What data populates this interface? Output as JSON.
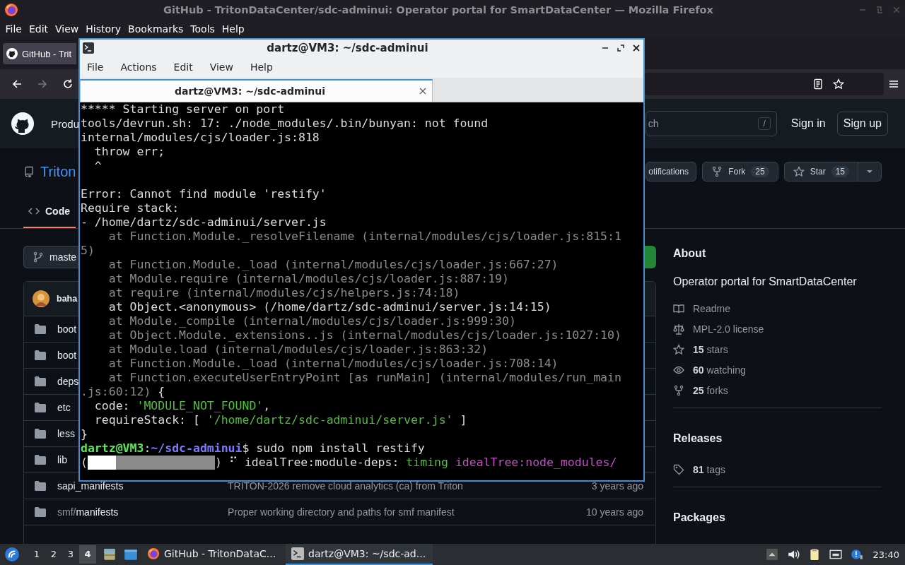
{
  "browser": {
    "title": "GitHub - TritonDataCenter/sdc-adminui: Operator portal for SmartDataCenter — Mozilla Firefox",
    "menu": [
      "File",
      "Edit",
      "View",
      "History",
      "Bookmarks",
      "Tools",
      "Help"
    ],
    "tab": {
      "label": "GitHub - Trit",
      "selected": true
    }
  },
  "github": {
    "nav_item": "Produ",
    "search": {
      "placeholder": "ch",
      "key": "/"
    },
    "sign_in": "Sign in",
    "sign_up": "Sign up",
    "repo_name": "Triton",
    "actions": [
      {
        "kind": "notifications",
        "label": "otifications"
      },
      {
        "kind": "fork",
        "label": "Fork",
        "count": "25"
      },
      {
        "kind": "star",
        "label": "Star",
        "count": "15"
      }
    ],
    "tabs": [
      {
        "label": "Code",
        "selected": true
      }
    ],
    "branch": "maste",
    "commit_author": "baha",
    "files": [
      {
        "name": "boot"
      },
      {
        "name": "boot"
      },
      {
        "name": "deps"
      },
      {
        "name": "etc"
      },
      {
        "name": "less"
      },
      {
        "name": "lib"
      },
      {
        "name": "sapi_manifests",
        "message": "TRITON-2026 remove cloud analytics (ca) from Triton",
        "date": "3 years ago"
      },
      {
        "prefix": "smf/",
        "name": "manifests",
        "message": "Proper working directory and paths for smf manifest",
        "date": "10 years ago"
      }
    ],
    "about": {
      "heading": "About",
      "description": "Operator portal for SmartDataCenter",
      "links": [
        {
          "kind": "readme",
          "text": "Readme"
        },
        {
          "kind": "license",
          "text": "MPL-2.0 license"
        },
        {
          "kind": "stars",
          "text": "**15** stars"
        },
        {
          "kind": "watching",
          "text": "**60** watching"
        },
        {
          "kind": "forks",
          "text": "**25** forks"
        }
      ]
    },
    "releases": {
      "heading": "Releases",
      "text": "**81** tags"
    },
    "packages": {
      "heading": "Packages"
    }
  },
  "terminal": {
    "title": "dartz@VM3: ~/sdc-adminui",
    "menu": [
      "File",
      "Actions",
      "Edit",
      "View",
      "Help"
    ],
    "tab": {
      "label": "dartz@VM3: ~/sdc-adminui",
      "selected": true
    },
    "lines": [
      {
        "kind": "text",
        "segments": [
          {
            "kind": "plain",
            "text": "***** Starting server on port"
          }
        ]
      },
      {
        "kind": "text",
        "segments": [
          {
            "kind": "plain",
            "text": "tools/devrun.sh: 17: ./node_modules/.bin/bunyan: not found"
          }
        ]
      },
      {
        "kind": "text",
        "segments": [
          {
            "kind": "plain",
            "text": "internal/modules/cjs/loader.js:818"
          }
        ]
      },
      {
        "kind": "text",
        "segments": [
          {
            "kind": "plain",
            "text": "  throw err;"
          }
        ]
      },
      {
        "kind": "text",
        "segments": [
          {
            "kind": "plain",
            "text": "  ^"
          }
        ]
      },
      {
        "kind": "blank"
      },
      {
        "kind": "text",
        "segments": [
          {
            "kind": "plain",
            "text": "Error: Cannot find module 'restify'"
          }
        ]
      },
      {
        "kind": "text",
        "segments": [
          {
            "kind": "plain",
            "text": "Require stack:"
          }
        ]
      },
      {
        "kind": "text",
        "segments": [
          {
            "kind": "plain",
            "text": "- /home/dartz/sdc-adminui/server.js"
          }
        ]
      },
      {
        "kind": "text",
        "segments": [
          {
            "kind": "dim",
            "text": "    at Function.Module._resolveFilename (internal/modules/cjs/loader.js:815:1"
          }
        ]
      },
      {
        "kind": "text",
        "segments": [
          {
            "kind": "dim",
            "text": "5)"
          }
        ]
      },
      {
        "kind": "text",
        "segments": [
          {
            "kind": "dim",
            "text": "    at Function.Module._load (internal/modules/cjs/loader.js:667:27)"
          }
        ]
      },
      {
        "kind": "text",
        "segments": [
          {
            "kind": "dim",
            "text": "    at Module.require (internal/modules/cjs/loader.js:887:19)"
          }
        ]
      },
      {
        "kind": "text",
        "segments": [
          {
            "kind": "dim",
            "text": "    at require (internal/modules/cjs/helpers.js:74:18)"
          }
        ]
      },
      {
        "kind": "text",
        "segments": [
          {
            "kind": "plain",
            "text": "    at Object.<anonymous> (/home/dartz/sdc-adminui/server.js:14:15)"
          }
        ]
      },
      {
        "kind": "text",
        "segments": [
          {
            "kind": "dim",
            "text": "    at Module._compile (internal/modules/cjs/loader.js:999:30)"
          }
        ]
      },
      {
        "kind": "text",
        "segments": [
          {
            "kind": "dim",
            "text": "    at Object.Module._extensions..js (internal/modules/cjs/loader.js:1027:10)"
          }
        ]
      },
      {
        "kind": "text",
        "segments": [
          {
            "kind": "dim",
            "text": "    at Module.load (internal/modules/cjs/loader.js:863:32)"
          }
        ]
      },
      {
        "kind": "text",
        "segments": [
          {
            "kind": "dim",
            "text": "    at Function.Module._load (internal/modules/cjs/loader.js:708:14)"
          }
        ]
      },
      {
        "kind": "text",
        "segments": [
          {
            "kind": "dim",
            "text": "    at Function.executeUserEntryPoint [as runMain] (internal/modules/run_main"
          }
        ]
      },
      {
        "kind": "text",
        "segments": [
          {
            "kind": "dim",
            "text": ".js:60:12)"
          },
          {
            "kind": "plain",
            "text": " {"
          }
        ]
      },
      {
        "kind": "text",
        "segments": [
          {
            "kind": "plain",
            "text": "  code: "
          },
          {
            "kind": "string",
            "text": "'MODULE_NOT_FOUND'"
          },
          {
            "kind": "plain",
            "text": ","
          }
        ]
      },
      {
        "kind": "text",
        "segments": [
          {
            "kind": "plain",
            "text": "  requireStack: [ "
          },
          {
            "kind": "string",
            "text": "'/home/dartz/sdc-adminui/server.js'"
          },
          {
            "kind": "plain",
            "text": " ]"
          }
        ]
      },
      {
        "kind": "text",
        "segments": [
          {
            "kind": "plain",
            "text": "}"
          }
        ]
      },
      {
        "kind": "text",
        "segments": [
          {
            "kind": "user",
            "text": "dartz@VM3"
          },
          {
            "kind": "plain",
            "text": ":"
          },
          {
            "kind": "path",
            "text": "~/sdc-adminui"
          },
          {
            "kind": "plain",
            "text": "$ sudo npm install restify"
          }
        ]
      },
      {
        "kind": "progress",
        "open": "(",
        "level": 0.22,
        "close": ")",
        "spinner": "⠋",
        "segments": [
          {
            "kind": "plain",
            "text": "idealTree:module-deps: "
          },
          {
            "kind": "string",
            "text": "timing"
          },
          {
            "kind": "highlight",
            "text": " idealTree:node_modules/"
          }
        ]
      }
    ]
  },
  "taskbar": {
    "workspaces": [
      {
        "label": "1",
        "selected": false
      },
      {
        "label": "2",
        "selected": false
      },
      {
        "label": "3",
        "selected": false
      },
      {
        "label": "4",
        "selected": true
      }
    ],
    "tasks": [
      {
        "kind": "browser",
        "label": "GitHub - TritonDataC...",
        "selected": false
      },
      {
        "kind": "terminal",
        "label": "dartz@VM3: ~/sdc-ad...",
        "selected": true
      }
    ],
    "clock": "23:40"
  }
}
